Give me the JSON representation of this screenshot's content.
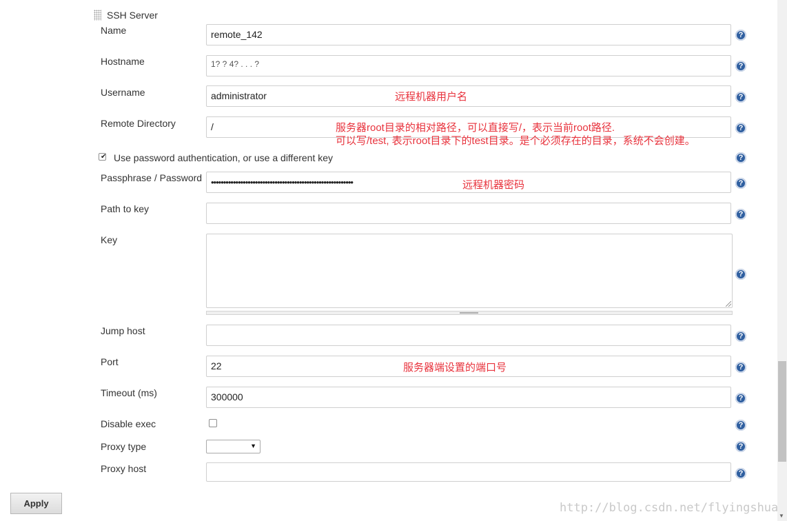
{
  "section": {
    "title": "SSH Server"
  },
  "fields": {
    "name": {
      "label": "Name",
      "value": "remote_142"
    },
    "hostname": {
      "label": "Hostname",
      "value": "1? ? 4?  .  .  . ?"
    },
    "username": {
      "label": "Username",
      "value": "administrator"
    },
    "remote_directory": {
      "label": "Remote Directory",
      "value": "/"
    },
    "use_password": {
      "label": "Use password authentication, or use a different key",
      "checked": true
    },
    "passphrase": {
      "label": "Passphrase / Password",
      "value": "••••••••••••••••••••••••••••••••••••••••••••••••••••••••••"
    },
    "path_to_key": {
      "label": "Path to key",
      "value": ""
    },
    "key": {
      "label": "Key",
      "value": ""
    },
    "jump_host": {
      "label": "Jump host",
      "value": ""
    },
    "port": {
      "label": "Port",
      "value": "22"
    },
    "timeout": {
      "label": "Timeout (ms)",
      "value": "300000"
    },
    "disable_exec": {
      "label": "Disable exec",
      "checked": false
    },
    "proxy_type": {
      "label": "Proxy type",
      "value": ""
    },
    "proxy_host": {
      "label": "Proxy host",
      "value": ""
    }
  },
  "annotations": {
    "username_note": "远程机器用户名",
    "dir_note_1": "服务器root目录的相对路径，可以直接写/，表示当前root路径.",
    "dir_note_2": "可以写/test, 表示root目录下的test目录。是个必须存在的目录，系统不会创建。",
    "password_note": "远程机器密码",
    "port_note": "服务器端设置的端口号"
  },
  "help_icon_glyph": "?",
  "apply_button": {
    "label": "Apply"
  },
  "watermark": "http://blog.csdn.net/flyingshuai",
  "colors": {
    "annotation": "#e8323c",
    "help_icon": "#2f5fa0"
  }
}
